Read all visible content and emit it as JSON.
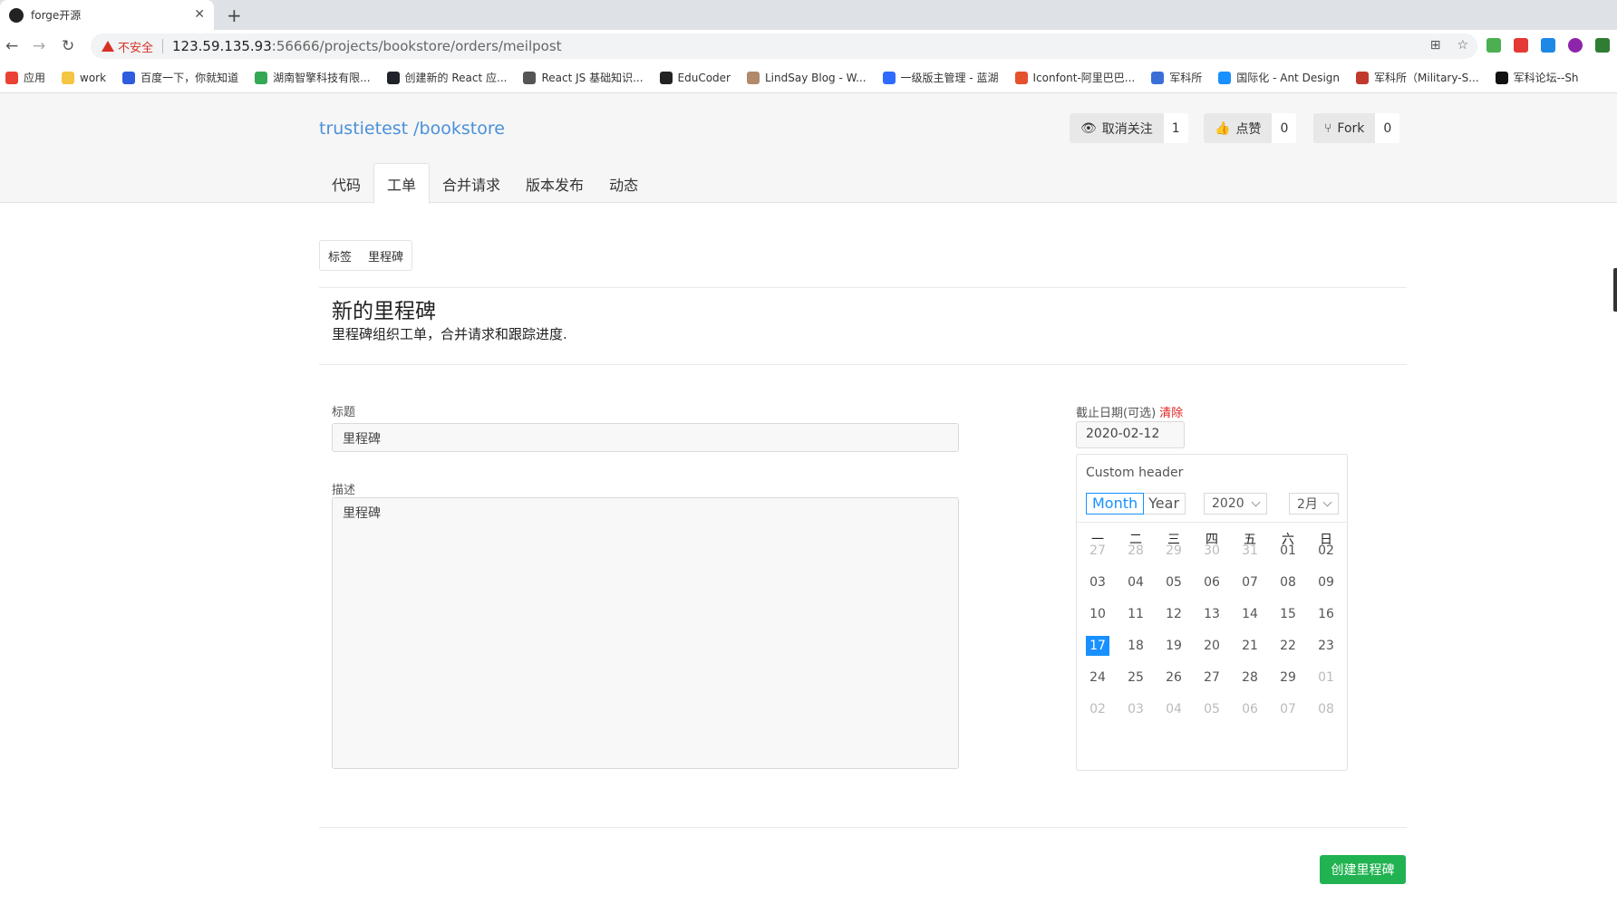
{
  "browser": {
    "tab_title": "forge开源",
    "security_label": "不安全",
    "url_host": "123.59.135.93",
    "url_rest": ":56666/projects/bookstore/orders/meilpost",
    "bookmarks": [
      {
        "label": "应用",
        "color": "#e94235"
      },
      {
        "label": "work",
        "color": "#f4c542"
      },
      {
        "label": "百度一下，你就知道",
        "color": "#2f5bde"
      },
      {
        "label": "湖南智擎科技有限...",
        "color": "#34a853"
      },
      {
        "label": "创建新的 React 应...",
        "color": "#20232a"
      },
      {
        "label": "React JS 基础知识...",
        "color": "#555555"
      },
      {
        "label": "EduCoder",
        "color": "#222222"
      },
      {
        "label": "LindSay Blog - W...",
        "color": "#b08a6a"
      },
      {
        "label": "一级版主管理 - 蓝湖",
        "color": "#2f6bff"
      },
      {
        "label": "Iconfont-阿里巴巴...",
        "color": "#e5502f"
      },
      {
        "label": "军科所",
        "color": "#3b6fd8"
      },
      {
        "label": "国际化 - Ant Design",
        "color": "#1890ff"
      },
      {
        "label": "军科所（Military-S...",
        "color": "#c0392b"
      },
      {
        "label": "军科论坛--Sh",
        "color": "#111111"
      }
    ]
  },
  "repo": {
    "title": "trustietest /bookstore",
    "watch": {
      "label": "取消关注",
      "count": "1"
    },
    "like": {
      "label": "点赞",
      "count": "0"
    },
    "fork": {
      "label": "Fork",
      "count": "0"
    },
    "tabs": [
      "代码",
      "工单",
      "合并请求",
      "版本发布",
      "动态"
    ]
  },
  "subtabs": [
    "标签",
    "里程碑"
  ],
  "page": {
    "title": "新的里程碑",
    "description": "里程碑组织工单，合并请求和跟踪进度."
  },
  "form": {
    "title_label": "标题",
    "title_value": "里程碑",
    "desc_label": "描述",
    "desc_value": "里程碑",
    "due_label": "截止日期(可选)",
    "clear_label": "清除",
    "due_value": "2020-02-12",
    "submit_label": "创建里程碑"
  },
  "calendar": {
    "header_text": "Custom header",
    "mode_month": "Month",
    "mode_year": "Year",
    "year": "2020",
    "month": "2月",
    "weekdays": [
      "一",
      "二",
      "三",
      "四",
      "五",
      "六",
      "日"
    ],
    "weeks": [
      [
        "27",
        "28",
        "29",
        "30",
        "31",
        "01",
        "02"
      ],
      [
        "03",
        "04",
        "05",
        "06",
        "07",
        "08",
        "09"
      ],
      [
        "10",
        "11",
        "12",
        "13",
        "14",
        "15",
        "16"
      ],
      [
        "17",
        "18",
        "19",
        "20",
        "21",
        "22",
        "23"
      ],
      [
        "24",
        "25",
        "26",
        "27",
        "28",
        "29",
        "01"
      ],
      [
        "02",
        "03",
        "04",
        "05",
        "06",
        "07",
        "08"
      ]
    ],
    "selected": "17"
  }
}
